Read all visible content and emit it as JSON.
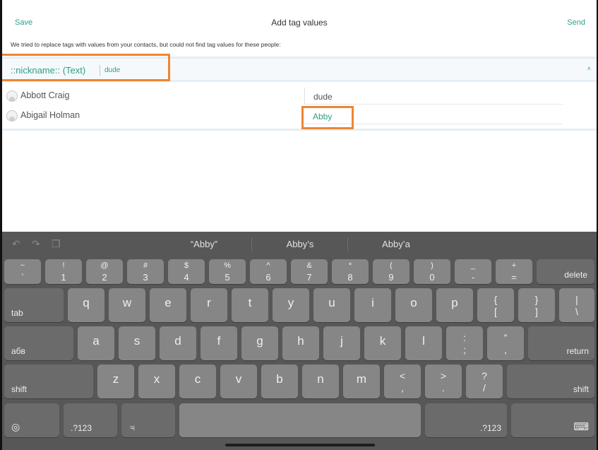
{
  "nav": {
    "save": "Save",
    "title": "Add tag values",
    "send": "Send"
  },
  "notice": "We tried to replace tags with values from your contacts, but could not find tag values for these people:",
  "tag": {
    "name": "::nickname:: (Text)",
    "default_value": "dude",
    "collapse_glyph": "˄"
  },
  "people": [
    {
      "name": "Abbott Craig",
      "value": "dude"
    },
    {
      "name": "Abigail Holman",
      "value": "Abby"
    }
  ],
  "keyboard": {
    "toolbar_icons": {
      "undo": "↶",
      "redo": "↷",
      "paste": "❐"
    },
    "suggestions": [
      "“Abby”",
      "Abby’s",
      "Abby’a"
    ],
    "number_row": [
      {
        "top": "~",
        "bottom": "`"
      },
      {
        "top": "!",
        "bottom": "1"
      },
      {
        "top": "@",
        "bottom": "2"
      },
      {
        "top": "#",
        "bottom": "3"
      },
      {
        "top": "$",
        "bottom": "4"
      },
      {
        "top": "%",
        "bottom": "5"
      },
      {
        "top": "^",
        "bottom": "6"
      },
      {
        "top": "&",
        "bottom": "7"
      },
      {
        "top": "*",
        "bottom": "8"
      },
      {
        "top": "(",
        "bottom": "9"
      },
      {
        "top": ")",
        "bottom": "0"
      },
      {
        "top": "_",
        "bottom": "-"
      },
      {
        "top": "+",
        "bottom": "="
      }
    ],
    "delete": "delete",
    "tab": "tab",
    "row_q": [
      "q",
      "w",
      "e",
      "r",
      "t",
      "y",
      "u",
      "i",
      "o",
      "p"
    ],
    "brace_open": {
      "top": "{",
      "bottom": "["
    },
    "brace_close": {
      "top": "}",
      "bottom": "]"
    },
    "pipe": {
      "top": "|",
      "bottom": "\\"
    },
    "lang": "абв",
    "row_a": [
      "a",
      "s",
      "d",
      "f",
      "g",
      "h",
      "j",
      "k",
      "l"
    ],
    "colon": {
      "top": ":",
      "bottom": ";"
    },
    "quote": {
      "top": "”",
      "bottom": ","
    },
    "return": "return",
    "shift": "shift",
    "row_z": [
      "z",
      "x",
      "c",
      "v",
      "b",
      "n",
      "m"
    ],
    "lt": {
      "top": "<",
      "bottom": ","
    },
    "gt": {
      "top": ">",
      "bottom": "."
    },
    "question": {
      "top": "?",
      "bottom": "/"
    },
    "numbers": ".?123",
    "globe_glyph": "◎",
    "mic_glyph": "♃",
    "hide_glyph": "⌨"
  }
}
